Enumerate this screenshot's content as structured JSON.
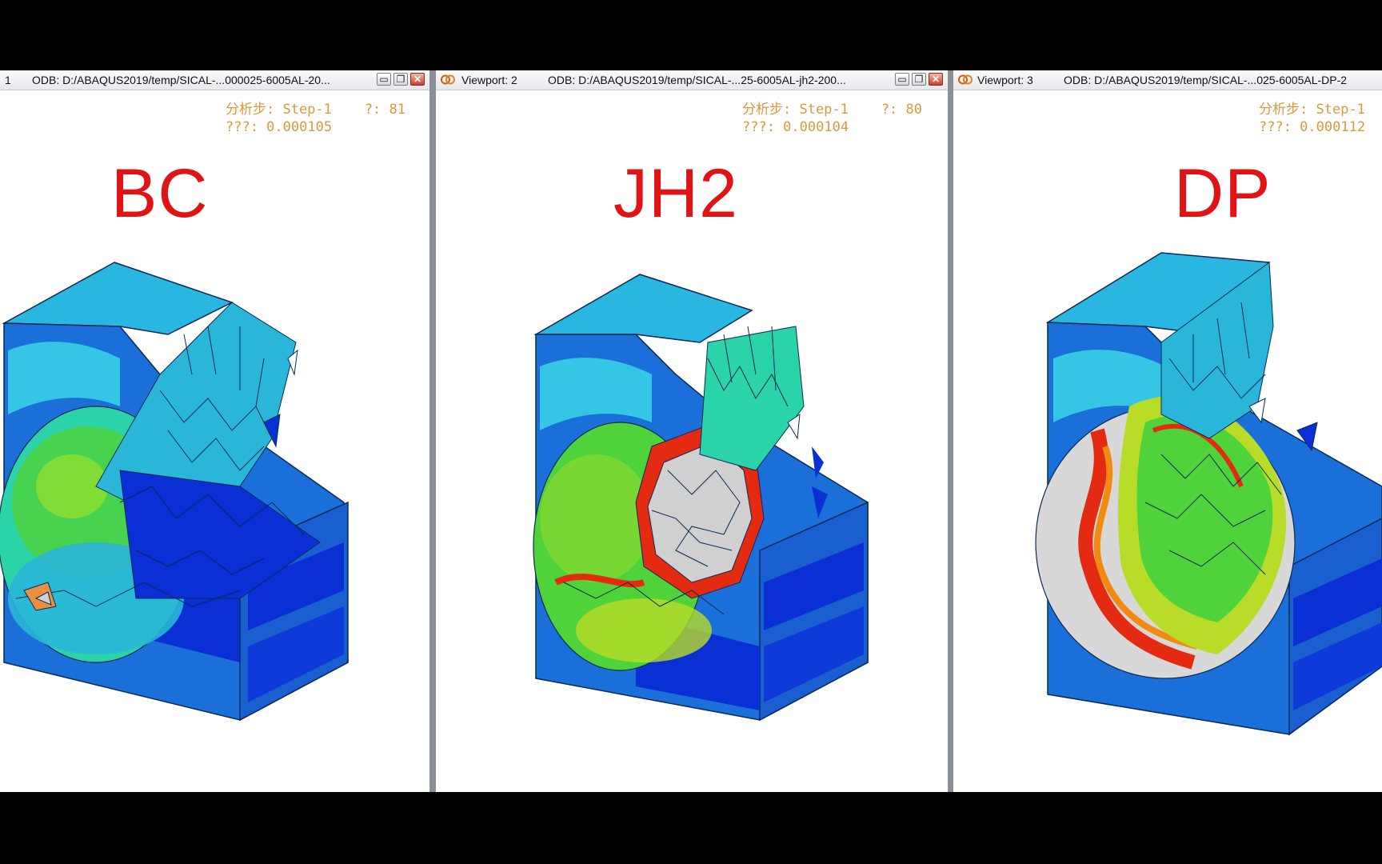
{
  "viewports": [
    {
      "number": "1",
      "viewport_label": "",
      "odb": "ODB: D:/ABAQUS2019/temp/SICAL-...000025-6005AL-20...",
      "step_line": "分析步: Step-1    ?: 81",
      "time_line": "???: 0.000105",
      "model_label": "BC"
    },
    {
      "number": "",
      "viewport_label": "Viewport: 2",
      "odb": "ODB: D:/ABAQUS2019/temp/SICAL-...25-6005AL-jh2-200...",
      "step_line": "分析步: Step-1    ?: 80",
      "time_line": "???: 0.000104",
      "model_label": "JH2"
    },
    {
      "number": "",
      "viewport_label": "Viewport: 3",
      "odb": "ODB: D:/ABAQUS2019/temp/SICAL-...025-6005AL-DP-2",
      "step_line": "分析步: Step-1",
      "time_line": "???: 0.000112",
      "model_label": "DP"
    }
  ],
  "window_buttons": {
    "minimize": "▭",
    "restore": "❐",
    "close": "✕"
  },
  "colors": {
    "label_red": "#e01414",
    "info_orange": "#d79a3a",
    "contour_dark_blue": "#0a2fd4",
    "contour_blue": "#1a6fd8",
    "contour_cyan": "#2ad3e0",
    "contour_green": "#4fd23a",
    "contour_yellow": "#e8e020",
    "contour_red": "#e42a10",
    "contour_gray": "#d0d0d0"
  }
}
